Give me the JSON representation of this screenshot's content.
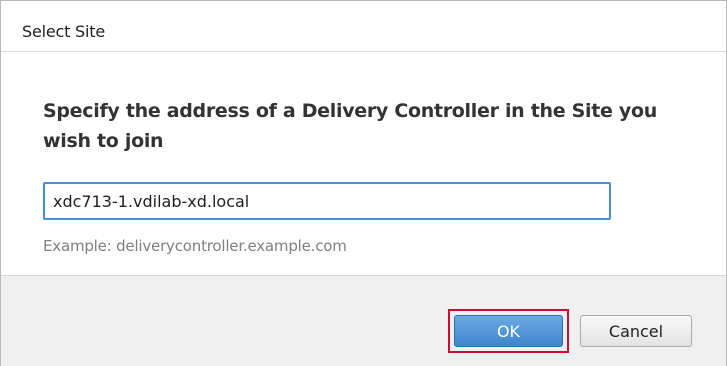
{
  "dialog": {
    "title": "Select Site"
  },
  "content": {
    "instruction": "Specify the address of a Delivery Controller in the Site you wish to join",
    "address_value": "xdc713-1.vdilab-xd.local",
    "example": "Example: deliverycontroller.example.com"
  },
  "footer": {
    "ok_label": "OK",
    "cancel_label": "Cancel"
  },
  "colors": {
    "ok_button": "#4a8fd6",
    "highlight": "#c8102e",
    "input_focus_border": "#4a8fd6"
  }
}
